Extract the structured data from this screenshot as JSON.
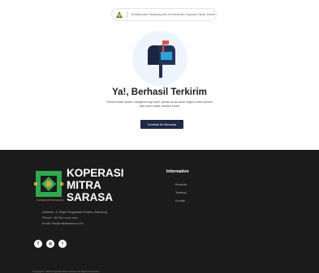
{
  "header": {
    "breadcrumb": "Terdaftar dan Didukung oleh Kementerian Koperasi Tanda Terima",
    "logo_icon": "koperasi-logo-icon"
  },
  "main": {
    "title": "Ya!, Berhasil Terkirim",
    "description": "Terima kasih sudah menghubungi kami, pesan anda akan segera kami proses dan kami balas melalui email",
    "button_label": "Kembali Ke Beranda",
    "illustration_icon": "mailbox-icon"
  },
  "footer": {
    "brand_line1": "KOPERASI",
    "brand_line2": "MITRA",
    "brand_line3": "SARASA",
    "brand_subtext": "KOPERASI MITRA SARASA",
    "address_line1": "Address: Jl. Raya Tangkuban Perahu, Bandung",
    "address_line2": "Phone: +62 8xx xxxx xxxx",
    "address_line3": "Email: info@mitrasarasa.co.id",
    "social": [
      {
        "icon": "facebook-icon",
        "glyph": "f"
      },
      {
        "icon": "instagram-icon",
        "glyph": "◎"
      },
      {
        "icon": "twitter-icon",
        "glyph": "t"
      }
    ],
    "info_heading": "Information",
    "info_links": [
      "Beranda",
      "Tentang",
      "Kontak"
    ],
    "copyright": "Copyright © 2024 Koperasi Mitra Sarasa. All Rights Reserved."
  },
  "colors": {
    "accent_dark": "#1f2845",
    "footer_bg": "#1b1b1b",
    "brand_green": "#2fa84f",
    "brand_gold": "#c9a64a"
  }
}
